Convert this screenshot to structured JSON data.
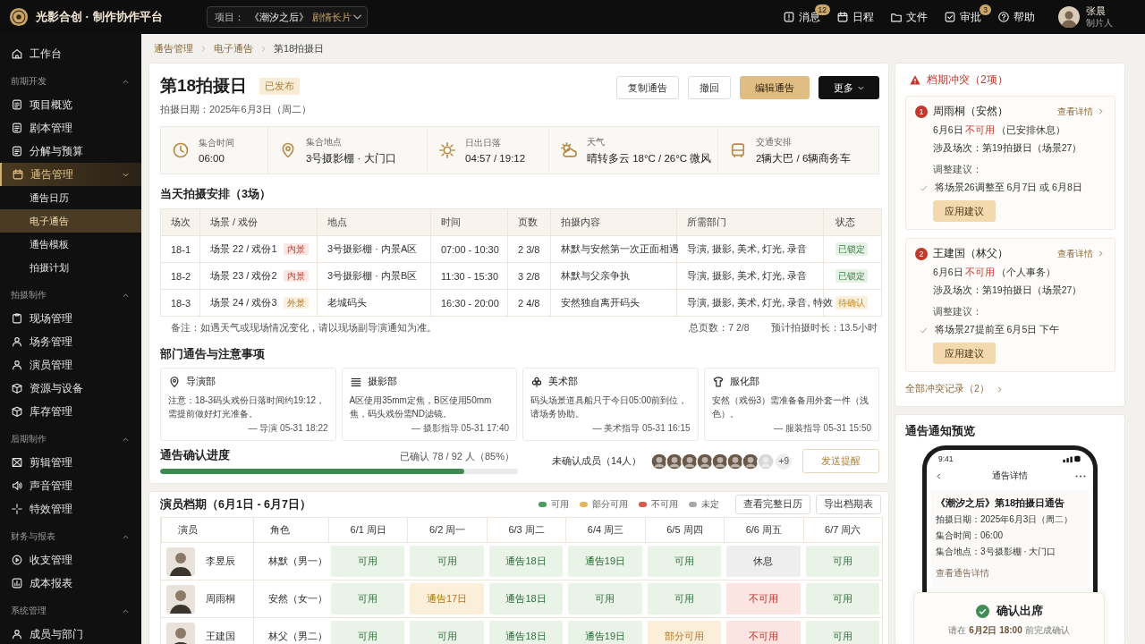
{
  "topbar": {
    "brand": "光影合创 · 制作协作平台",
    "project_label": "项目：",
    "project_name": "《潮汐之后》",
    "project_type": "剧情长片",
    "nav": [
      {
        "label": "消息",
        "badge": "12"
      },
      {
        "label": "日程"
      },
      {
        "label": "文件"
      },
      {
        "label": "审批",
        "badge": "3"
      },
      {
        "label": "帮助"
      }
    ],
    "user": {
      "name": "张晨",
      "role": "制片人"
    }
  },
  "sidebar": [
    {
      "kind": "item",
      "label": "工作台",
      "selected": false
    },
    {
      "kind": "group",
      "label": "前期开发",
      "expanded": true,
      "children": [
        {
          "label": "项目概览",
          "selected": false
        },
        {
          "label": "剧本管理",
          "selected": false
        },
        {
          "label": "分解与预算",
          "selected": false
        },
        {
          "label": "通告管理",
          "selected": true,
          "expanded": true,
          "children": [
            {
              "label": "通告日历",
              "selected": false
            },
            {
              "label": "电子通告",
              "selected": true
            },
            {
              "label": "通告模板",
              "selected": false
            },
            {
              "label": "拍摄计划",
              "selected": false
            }
          ]
        }
      ]
    },
    {
      "kind": "group",
      "label": "拍摄制作",
      "expanded": true,
      "children": [
        {
          "label": "现场管理",
          "selected": false
        },
        {
          "label": "场务管理",
          "selected": false
        },
        {
          "label": "演员管理",
          "selected": false
        },
        {
          "label": "资源与设备",
          "selected": false
        },
        {
          "label": "库存管理",
          "selected": false
        }
      ]
    },
    {
      "kind": "group",
      "label": "后期制作",
      "expanded": true,
      "children": [
        {
          "label": "剪辑管理",
          "selected": false
        },
        {
          "label": "声音管理",
          "selected": false
        },
        {
          "label": "特效管理",
          "selected": false
        }
      ]
    },
    {
      "kind": "group",
      "label": "财务与报表",
      "expanded": true,
      "children": [
        {
          "label": "收支管理",
          "selected": false
        },
        {
          "label": "成本报表",
          "selected": false
        }
      ]
    },
    {
      "kind": "group",
      "label": "系统管理",
      "expanded": true,
      "children": [
        {
          "label": "成员与部门",
          "selected": false
        }
      ]
    }
  ],
  "breadcrumb": [
    "通告管理",
    "电子通告",
    "第18拍摄日"
  ],
  "notice": {
    "title": "第18拍摄日",
    "status": "已发布",
    "date": "拍摄日期：2025年6月3日（周二）",
    "actions": [
      {
        "label": "复制通告",
        "kind": "default"
      },
      {
        "label": "撤回",
        "kind": "default"
      },
      {
        "label": "编辑通告",
        "kind": "primary"
      },
      {
        "label": "更多",
        "kind": "dark"
      }
    ]
  },
  "info": [
    {
      "label": "集合时间",
      "value": "06:00"
    },
    {
      "label": "集合地点",
      "value": "3号摄影棚 · 大门口"
    },
    {
      "label": "日出日落",
      "value": "04:57 / 19:12"
    },
    {
      "label": "天气",
      "value": "晴转多云 18°C / 26°C  微风"
    },
    {
      "label": "交通安排",
      "value": "2辆大巴 / 6辆商务车"
    }
  ],
  "schedule": {
    "title": "当天拍摄安排（3场）",
    "columns": [
      "场次",
      "场景 / 戏份",
      "地点",
      "时间",
      "页数",
      "拍摄内容",
      "所需部门",
      "状态"
    ],
    "rows": [
      {
        "scene": "18-1",
        "part": "场景 22 / 戏份1",
        "tag": {
          "label": "内景",
          "kind": "interior"
        },
        "location": "3号摄影棚 · 内景A区",
        "time": "07:00 - 10:30",
        "pages": "2 3/8",
        "content": "林默与安然第一次正面相遇",
        "departments": "导演, 摄影, 美术, 灯光, 录音",
        "status": {
          "label": "已锁定",
          "kind": "locked"
        }
      },
      {
        "scene": "18-2",
        "part": "场景 23 / 戏份2",
        "tag": {
          "label": "内景",
          "kind": "interior"
        },
        "location": "3号摄影棚 · 内景B区",
        "time": "11:30 - 15:30",
        "pages": "3 2/8",
        "content": "林默与父亲争执",
        "departments": "导演, 摄影, 美术, 灯光, 录音",
        "status": {
          "label": "已锁定",
          "kind": "locked"
        }
      },
      {
        "scene": "18-3",
        "part": "场景 24 / 戏份3",
        "tag": {
          "label": "外景",
          "kind": "exterior"
        },
        "location": "老城码头",
        "time": "16:30 - 20:00",
        "pages": "2 4/8",
        "content": "安然独自离开码头",
        "departments": "导演, 摄影, 美术, 灯光, 录音, 特效",
        "status": {
          "label": "待确认",
          "kind": "pending"
        }
      }
    ],
    "note": "备注：如遇天气或现场情况变化，请以现场副导演通知为准。",
    "total_pages": "总页数：7 2/8",
    "duration": "预计拍摄时长：13.5小时"
  },
  "departments": {
    "title": "部门通告与注意事项",
    "cards": [
      {
        "name": "导演部",
        "text": "注意：18-3码头戏份日落时间约19:12，需提前做好灯光准备。",
        "footer": "— 导演  05-31 18:22"
      },
      {
        "name": "摄影部",
        "text": "A区使用35mm定焦，B区使用50mm焦，码头戏份需ND滤镜。",
        "footer": "— 摄影指导  05-31 17:40"
      },
      {
        "name": "美术部",
        "text": "码头场景道具船只于今日05:00前到位，请场务协助。",
        "footer": "— 美术指导  05-31 16:15"
      },
      {
        "name": "服化部",
        "text": "安然（戏份3）需准备备用外套一件（浅色）。",
        "footer": "— 服装指导  05-31 15:50"
      }
    ]
  },
  "confirmation": {
    "title": "通告确认进度",
    "reading": "已确认 78 / 92 人（85%）",
    "level": 0.85,
    "unconfirmed_label": "未确认成员（14人）",
    "avatars": [
      {
        "kind": "photo"
      },
      {
        "kind": "photo"
      },
      {
        "kind": "photo"
      },
      {
        "kind": "photo"
      },
      {
        "kind": "photo"
      },
      {
        "kind": "photo"
      },
      {
        "kind": "photo"
      },
      {
        "kind": "placeholder"
      }
    ],
    "more": "+9",
    "button": "发送提醒"
  },
  "availability": {
    "title": "演员档期（6月1日 - 6月7日）",
    "legend": [
      {
        "label": "可用",
        "color": "#4f9a5f"
      },
      {
        "label": "部分可用",
        "color": "#e2b65c"
      },
      {
        "label": "不可用",
        "color": "#d65a4f"
      },
      {
        "label": "未定",
        "color": "#a9a9a9"
      }
    ],
    "buttons": [
      "查看完整日历",
      "导出档期表"
    ],
    "columns": [
      "演员",
      "角色"
    ],
    "days": [
      "6/1 周日",
      "6/2 周一",
      "6/3 周二",
      "6/4 周三",
      "6/5 周四",
      "6/6 周五",
      "6/7 周六"
    ],
    "rows": [
      {
        "actor": "李昱辰",
        "role": "林默（男一）",
        "cells": [
          {
            "label": "可用",
            "kind": "available"
          },
          {
            "label": "可用",
            "kind": "available"
          },
          {
            "label": "通告18日",
            "kind": "available"
          },
          {
            "label": "通告19日",
            "kind": "available"
          },
          {
            "label": "可用",
            "kind": "available"
          },
          {
            "label": "休息",
            "kind": "rest"
          },
          {
            "label": "可用",
            "kind": "available"
          }
        ]
      },
      {
        "actor": "周雨桐",
        "role": "安然（女一）",
        "cells": [
          {
            "label": "可用",
            "kind": "available"
          },
          {
            "label": "通告17日",
            "kind": "partial"
          },
          {
            "label": "通告18日",
            "kind": "available"
          },
          {
            "label": "可用",
            "kind": "available"
          },
          {
            "label": "可用",
            "kind": "available"
          },
          {
            "label": "不可用",
            "kind": "unavailable"
          },
          {
            "label": "可用",
            "kind": "available"
          }
        ]
      },
      {
        "actor": "王建国",
        "role": "林父（男二）",
        "cells": [
          {
            "label": "可用",
            "kind": "available"
          },
          {
            "label": "可用",
            "kind": "available"
          },
          {
            "label": "通告18日",
            "kind": "available"
          },
          {
            "label": "通告19日",
            "kind": "available"
          },
          {
            "label": "部分可用",
            "kind": "partial"
          },
          {
            "label": "不可用",
            "kind": "unavailable"
          },
          {
            "label": "可用",
            "kind": "available"
          }
        ]
      }
    ]
  },
  "conflicts": {
    "title": "档期冲突（2项）",
    "items": [
      {
        "number": "1",
        "name": "周雨桐（安然）",
        "link": "查看详情",
        "date": "6月6日",
        "status": "不可用",
        "reason": "（已安排休息）",
        "scenes": "涉及场次：第19拍摄日（场景27）",
        "suggestion_label": "调整建议：",
        "suggestion": "将场景26调整至 6月7日 或 6月8日",
        "button": "应用建议"
      },
      {
        "number": "2",
        "name": "王建国（林父）",
        "link": "查看详情",
        "date": "6月6日",
        "status": "不可用",
        "reason": "（个人事务）",
        "scenes": "涉及场次：第19拍摄日（场景27）",
        "suggestion_label": "调整建议：",
        "suggestion": "将场景27提前至 6月5日 下午",
        "button": "应用建议"
      }
    ],
    "all_link": "全部冲突记录（2）"
  },
  "preview": {
    "title": "通告通知预览",
    "phone": {
      "time": "9:41",
      "header": "通告详情",
      "notice_title": "《潮汐之后》第18拍摄日通告",
      "lines": [
        "拍摄日期：2025年6月3日（周二）",
        "集合时间：06:00",
        "集合地点：3号摄影棚 · 大门口"
      ],
      "link": "查看通告详情"
    },
    "confirm": {
      "label": "确认出席",
      "hint": "请在 **6月2日 18:00** 前完成确认"
    }
  }
}
